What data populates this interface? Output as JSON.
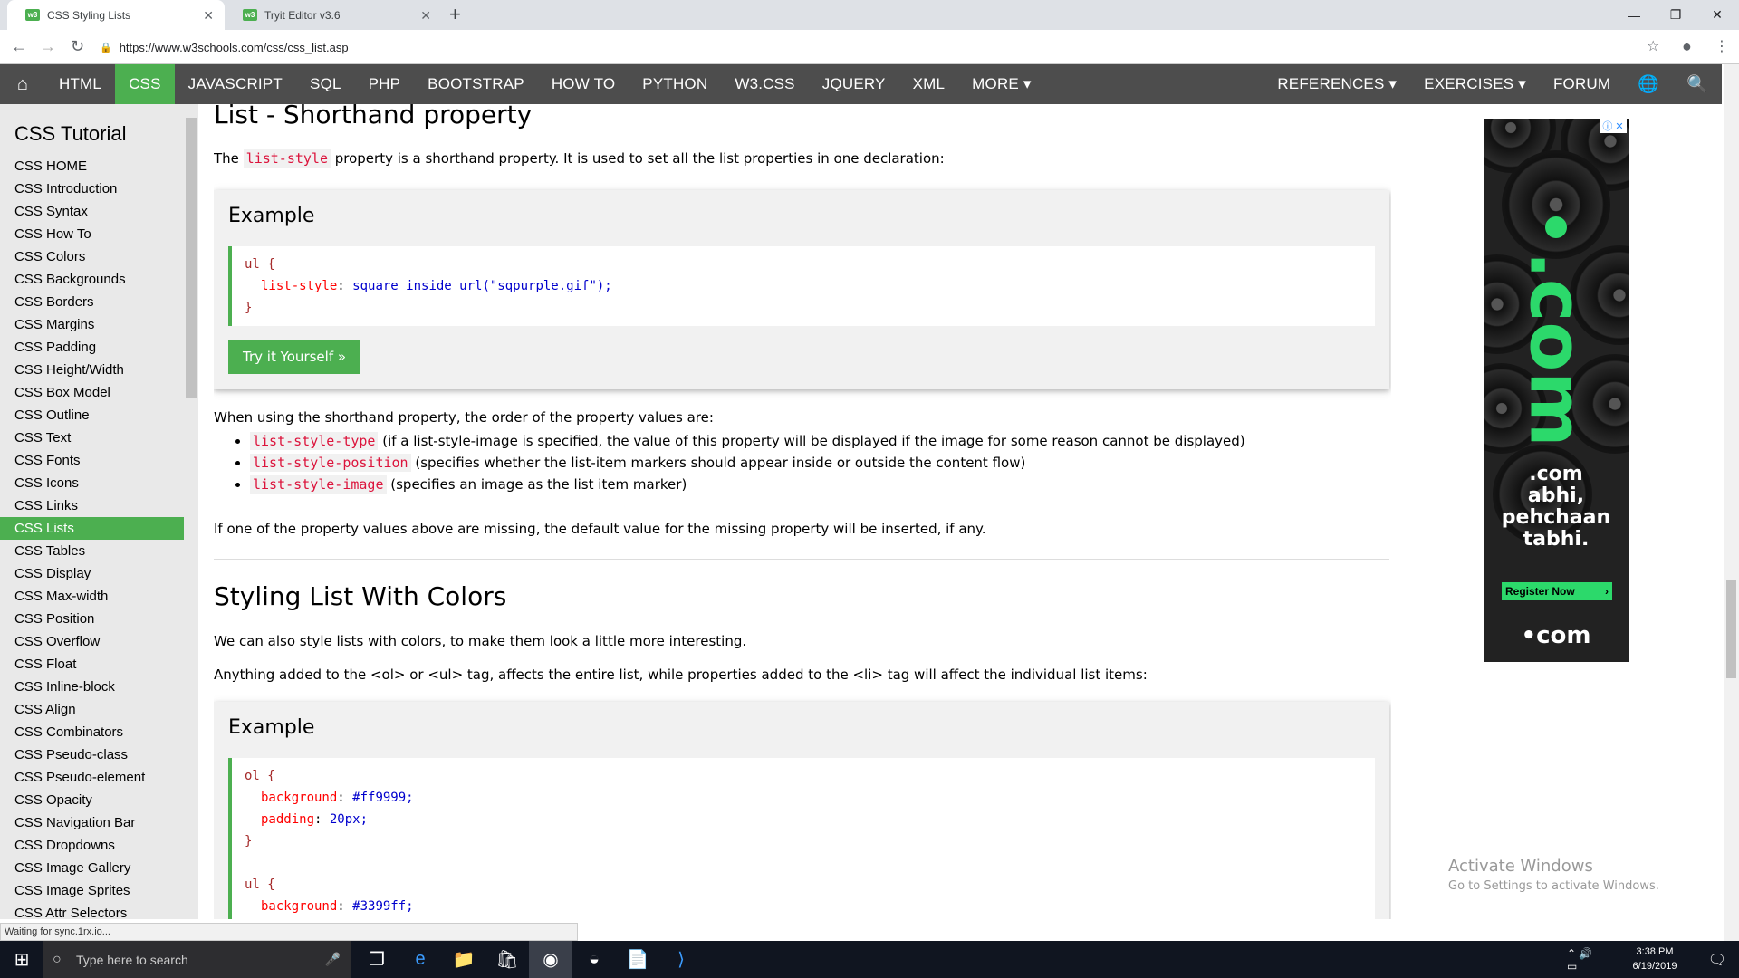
{
  "browser": {
    "tabs": [
      {
        "title": "CSS Styling Lists",
        "favicon": "w3"
      },
      {
        "title": "Tryit Editor v3.6",
        "favicon": "w3"
      }
    ],
    "new_tab": "+",
    "url": "https://www.w3schools.com/css/css_list.asp",
    "status": "Waiting for sync.1rx.io..."
  },
  "topnav": {
    "home_icon": "home-icon",
    "items": [
      "HTML",
      "CSS",
      "JAVASCRIPT",
      "SQL",
      "PHP",
      "BOOTSTRAP",
      "HOW TO",
      "PYTHON",
      "W3.CSS",
      "JQUERY",
      "XML",
      "MORE ▾"
    ],
    "right": [
      "REFERENCES ▾",
      "EXERCISES ▾",
      "FORUM"
    ],
    "active": "CSS"
  },
  "sidebar": {
    "title": "CSS Tutorial",
    "items": [
      "CSS HOME",
      "CSS Introduction",
      "CSS Syntax",
      "CSS How To",
      "CSS Colors",
      "CSS Backgrounds",
      "CSS Borders",
      "CSS Margins",
      "CSS Padding",
      "CSS Height/Width",
      "CSS Box Model",
      "CSS Outline",
      "CSS Text",
      "CSS Fonts",
      "CSS Icons",
      "CSS Links",
      "CSS Lists",
      "CSS Tables",
      "CSS Display",
      "CSS Max-width",
      "CSS Position",
      "CSS Overflow",
      "CSS Float",
      "CSS Inline-block",
      "CSS Align",
      "CSS Combinators",
      "CSS Pseudo-class",
      "CSS Pseudo-element",
      "CSS Opacity",
      "CSS Navigation Bar",
      "CSS Dropdowns",
      "CSS Image Gallery",
      "CSS Image Sprites",
      "CSS Attr Selectors"
    ],
    "active": "CSS Lists"
  },
  "main": {
    "heading1": "List - Shorthand property",
    "p1_pre": "The ",
    "p1_code": "list-style",
    "p1_post": " property is a shorthand property. It is used to set all the list properties in one declaration:",
    "example_label": "Example",
    "ex1": {
      "l1_sel": "ul {",
      "l2_prop": "list-style",
      "l2_val": " square inside url(\"sqpurple.gif\");",
      "l3": "}"
    },
    "try_button": "Try it Yourself »",
    "p2": "When using the shorthand property, the order of the property values are:",
    "list": [
      {
        "code": "list-style-type",
        "text": " (if a list-style-image is specified, the value of this property will be displayed if the image for some reason cannot be displayed)"
      },
      {
        "code": "list-style-position",
        "text": " (specifies whether the list-item markers should appear inside or outside the content flow)"
      },
      {
        "code": "list-style-image",
        "text": " (specifies an image as the list item marker)"
      }
    ],
    "p3": "If one of the property values above are missing, the default value for the missing property will be inserted, if any.",
    "heading2": "Styling List With Colors",
    "p4": "We can also style lists with colors, to make them look a little more interesting.",
    "p5": "Anything added to the <ol> or <ul> tag, affects the entire list, while properties added to the <li> tag will affect the individual list items:",
    "ex2": {
      "l1": "ol {",
      "l2_prop": "background",
      "l2_val": " #ff9999;",
      "l3_prop": "padding",
      "l3_val": " 20px;",
      "l4": "}",
      "l5": "ul {",
      "l6_prop": "background",
      "l6_val": " #3399ff;"
    }
  },
  "ad": {
    "big": ".com",
    "line1": ".com",
    "line2": "abhi,",
    "line3": "pehchaan",
    "line4": "tabhi.",
    "register": "Register Now",
    "footer": "•com",
    "badge": "ⓘ ✕"
  },
  "watermark": {
    "title": "Activate Windows",
    "sub": "Go to Settings to activate Windows."
  },
  "taskbar": {
    "search_placeholder": "Type here to search",
    "time": "3:38 PM",
    "date": "6/19/2019"
  },
  "colors": {
    "accent": "#4caf50",
    "nav": "#4d4d4d",
    "sidebar": "#e9e9e9",
    "code_keyword": "crimson"
  }
}
